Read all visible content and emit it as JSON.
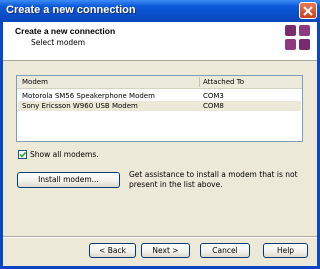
{
  "window": {
    "title": "Create a new connection"
  },
  "header": {
    "title": "Create a new connection",
    "subtitle": "Select modem"
  },
  "modem_list": {
    "columns": [
      "Modem",
      "Attached To"
    ],
    "rows": [
      {
        "modem": "Motorola SM56 Speakerphone Modem",
        "port": "COM3"
      },
      {
        "modem": "Sony Ericsson W960 USB Modem",
        "port": "COM8"
      }
    ]
  },
  "show_all": {
    "label": "Show all modems.",
    "checked": true
  },
  "install": {
    "button_label": "Install modem...",
    "assist_text": "Get assistance to install a modem that is not present in the list above."
  },
  "footer": {
    "back_label": "< Back",
    "next_label": "Next >",
    "cancel_label": "Cancel",
    "help_label": "Help"
  }
}
